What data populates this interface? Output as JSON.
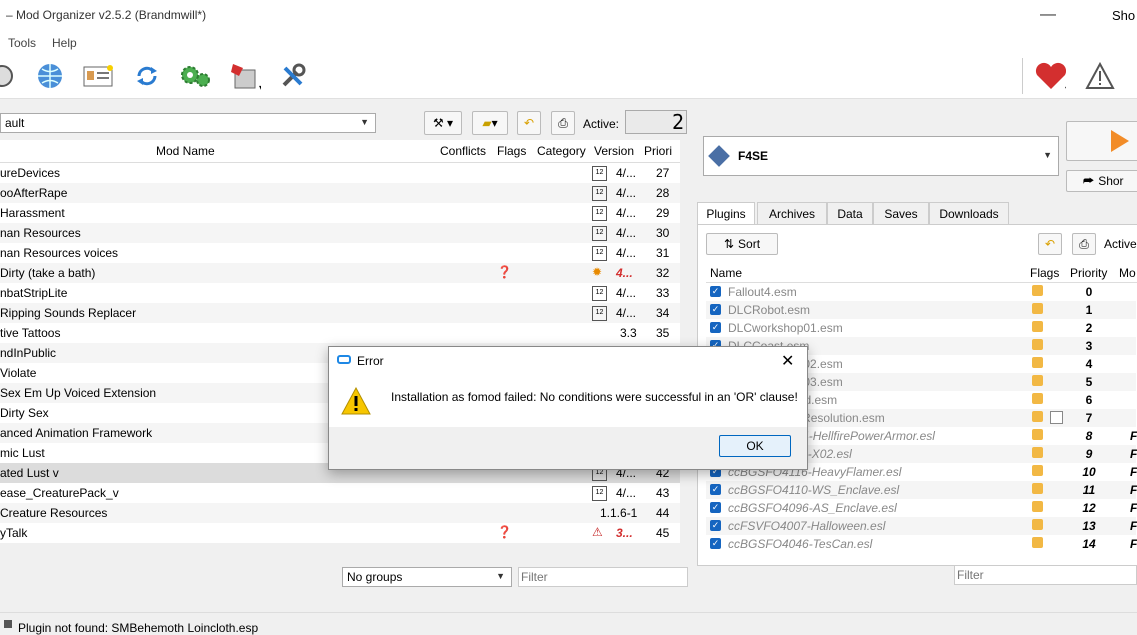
{
  "window": {
    "title": "– Mod Organizer v2.5.2 (Brandmwill*)",
    "help_q": "Sho"
  },
  "menu": {
    "tools": "Tools",
    "help": "Help"
  },
  "toolbar": {
    "icons": [
      "install-icon",
      "nexus-globe-icon",
      "profiles-icon",
      "refresh-icon",
      "executables-icon",
      "tools-icon",
      "settings-icon"
    ],
    "endorse_icon": "heart-icon",
    "problems_icon": "warning-icon"
  },
  "profile": {
    "value": "ault",
    "active_label": "Active:",
    "active_count": "2"
  },
  "modlist": {
    "headers": {
      "name": "Mod Name",
      "conflicts": "Conflicts",
      "flags": "Flags",
      "category": "Category",
      "version": "Version",
      "priority": "Priori"
    },
    "rows": [
      {
        "name": "ureDevices",
        "version": "4/...",
        "priority": "27",
        "icon": "cal"
      },
      {
        "name": "ooAfterRape",
        "version": "4/...",
        "priority": "28",
        "icon": "cal"
      },
      {
        "name": "Harassment",
        "version": "4/...",
        "priority": "29",
        "icon": "cal"
      },
      {
        "name": "nan Resources",
        "version": "4/...",
        "priority": "30",
        "icon": "cal"
      },
      {
        "name": "nan Resources voices",
        "version": "4/...",
        "priority": "31",
        "icon": "cal"
      },
      {
        "name": "Dirty (take a bath)",
        "version": "4...",
        "priority": "32",
        "icon": "gear",
        "flag": "?",
        "red": true
      },
      {
        "name": "nbatStripLite",
        "version": "4/...",
        "priority": "33",
        "icon": "cal"
      },
      {
        "name": "Ripping Sounds Replacer",
        "version": "4/...",
        "priority": "34",
        "icon": "cal"
      },
      {
        "name": "tive Tattoos",
        "version": "3.3",
        "priority": "35",
        "icon": ""
      },
      {
        "name": "ndInPublic",
        "version": "",
        "priority": "",
        "icon": ""
      },
      {
        "name": "Violate",
        "version": "",
        "priority": "",
        "icon": ""
      },
      {
        "name": "Sex Em Up Voiced Extension",
        "version": "",
        "priority": "",
        "icon": ""
      },
      {
        "name": "Dirty Sex",
        "version": "",
        "priority": "",
        "icon": ""
      },
      {
        "name": "anced Animation Framework",
        "version": "",
        "priority": "",
        "icon": ""
      },
      {
        "name": "mic Lust",
        "version": "",
        "priority": "",
        "icon": ""
      },
      {
        "name": "ated Lust v",
        "version": "4/...",
        "priority": "42",
        "icon": "cal"
      },
      {
        "name": "ease_CreaturePack_v",
        "version": "4/...",
        "priority": "43",
        "icon": "cal"
      },
      {
        "name": "Creature Resources",
        "version": "1.1.6-1",
        "priority": "44",
        "icon": ""
      },
      {
        "name": "yTalk",
        "version": "3...",
        "priority": "45",
        "icon": "warn",
        "flag": "?",
        "red": true
      }
    ],
    "groups": "No groups",
    "filter_placeholder": "Filter"
  },
  "executable": {
    "value": "F4SE",
    "run_label": "Shor"
  },
  "tabs": [
    "Plugins",
    "Archives",
    "Data",
    "Saves",
    "Downloads"
  ],
  "plugins": {
    "sort_label": "Sort",
    "active_label": "Active",
    "headers": {
      "name": "Name",
      "flags": "Flags",
      "priority": "Priority",
      "mod": "Mo"
    },
    "rows": [
      {
        "name": "Fallout4.esm",
        "priority": "0"
      },
      {
        "name": "DLCRobot.esm",
        "priority": "1"
      },
      {
        "name": "DLCworkshop01.esm",
        "priority": "2"
      },
      {
        "name": "DLCCoast.esm",
        "priority": "3"
      },
      {
        "name": "DLCworkshop02.esm",
        "priority": "4"
      },
      {
        "name": "DLCworkshop03.esm",
        "priority": "5"
      },
      {
        "name": "DLCNukaWorld.esm",
        "priority": "6"
      },
      {
        "name": "DLCUltraHighResolution.esm",
        "priority": "7"
      },
      {
        "name": "ccBGSFO4044-HellfirePowerArmor.esl",
        "priority": "8",
        "italic": true,
        "mod": "F"
      },
      {
        "name": "ccBGSFO4115-X02.esl",
        "priority": "9",
        "italic": true,
        "mod": "F"
      },
      {
        "name": "ccBGSFO4116-HeavyFlamer.esl",
        "priority": "10",
        "italic": true,
        "mod": "F"
      },
      {
        "name": "ccBGSFO4110-WS_Enclave.esl",
        "priority": "11",
        "italic": true,
        "mod": "F"
      },
      {
        "name": "ccBGSFO4096-AS_Enclave.esl",
        "priority": "12",
        "italic": true,
        "mod": "F"
      },
      {
        "name": "ccFSVFO4007-Halloween.esl",
        "priority": "13",
        "italic": true,
        "mod": "F"
      },
      {
        "name": "ccBGSFO4046-TesCan.esl",
        "priority": "14",
        "italic": true,
        "mod": "F"
      }
    ],
    "filter_placeholder": "Filter"
  },
  "dialog": {
    "title": "Error",
    "message": "Installation as fomod failed: No conditions were successful in an 'OR' clause!",
    "ok": "OK"
  },
  "status": {
    "message": "Plugin not found: SMBehemoth Loincloth.esp"
  }
}
